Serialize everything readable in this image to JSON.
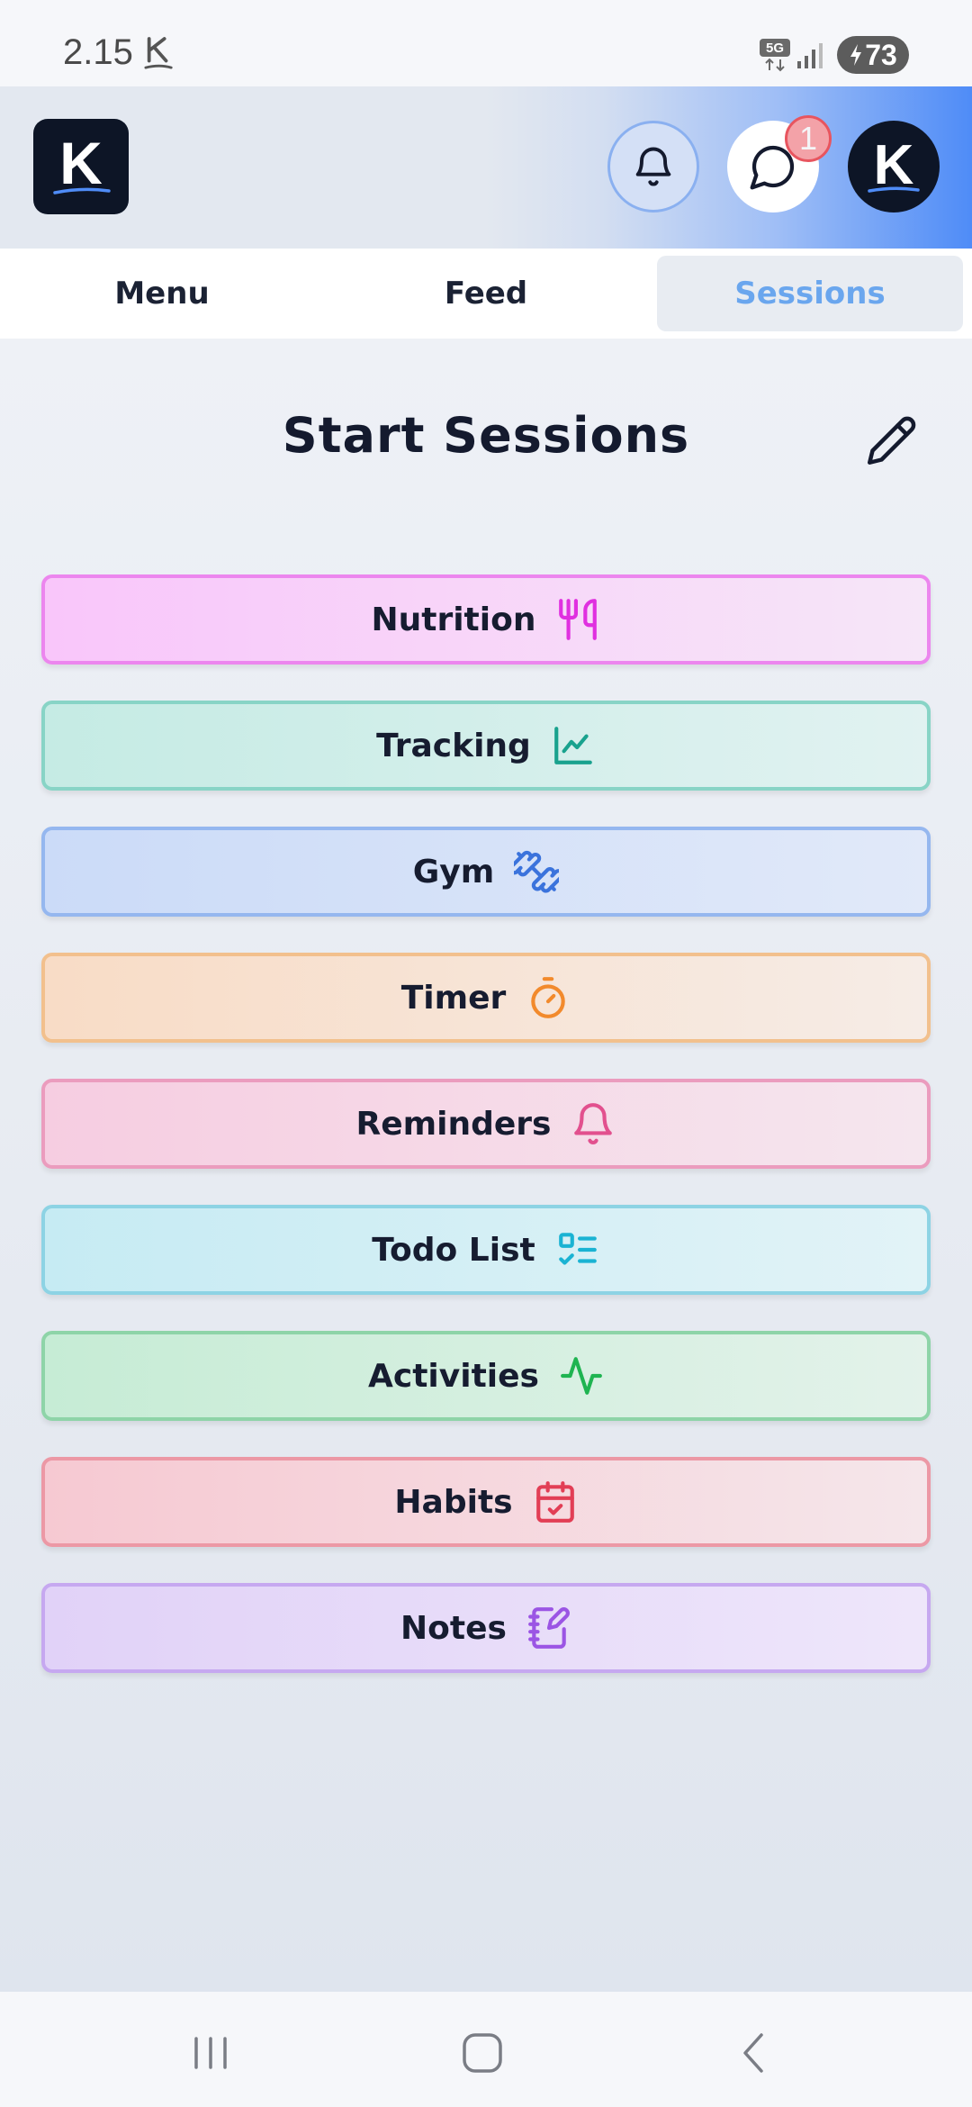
{
  "status": {
    "time": "2.15",
    "network": "5G",
    "battery": "73"
  },
  "header": {
    "logo_letter": "K",
    "avatar_letter": "K",
    "chat_badge_count": "1",
    "icons": [
      "bell-icon",
      "chat-bubble-icon"
    ]
  },
  "tabs": [
    {
      "label": "Menu",
      "active": false
    },
    {
      "label": "Feed",
      "active": false
    },
    {
      "label": "Sessions",
      "active": true
    }
  ],
  "main": {
    "title": "Start Sessions",
    "edit_icon": "pencil-icon",
    "sessions": [
      {
        "label": "Nutrition",
        "icon": "fork-knife-icon",
        "color": "#e030e0",
        "bg_from": "#f9c6fa",
        "bg_to": "#f6e6f8",
        "border": "#ec86ee"
      },
      {
        "label": "Tracking",
        "icon": "line-chart-icon",
        "color": "#19a28e",
        "bg_from": "#c5ebe4",
        "bg_to": "#e1f2f1",
        "border": "#88d4c6"
      },
      {
        "label": "Gym",
        "icon": "dumbbell-icon",
        "color": "#3b73dc",
        "bg_from": "#cbdbf8",
        "bg_to": "#e1e9f9",
        "border": "#95b7ef"
      },
      {
        "label": "Timer",
        "icon": "stopwatch-icon",
        "color": "#f28a2c",
        "bg_from": "#f8dcc6",
        "bg_to": "#f6ece6",
        "border": "#f2c08d"
      },
      {
        "label": "Reminders",
        "icon": "bell-icon",
        "color": "#e2508e",
        "bg_from": "#f6cde1",
        "bg_to": "#f5e6ee",
        "border": "#eb9cbe"
      },
      {
        "label": "Todo List",
        "icon": "checklist-icon",
        "color": "#1ab3d3",
        "bg_from": "#c6ebf3",
        "bg_to": "#e2f3f7",
        "border": "#8dd3e4"
      },
      {
        "label": "Activities",
        "icon": "activity-pulse-icon",
        "color": "#1fb451",
        "bg_from": "#c6ecd5",
        "bg_to": "#e3f2ea",
        "border": "#8ed4a8"
      },
      {
        "label": "Habits",
        "icon": "calendar-check-icon",
        "color": "#e23e55",
        "bg_from": "#f6c9d2",
        "bg_to": "#f5e6ea",
        "border": "#ec98a5"
      },
      {
        "label": "Notes",
        "icon": "notebook-pen-icon",
        "color": "#9b55e4",
        "bg_from": "#e1d2f8",
        "bg_to": "#eee6fa",
        "border": "#c6a8f0"
      }
    ]
  },
  "navbar": {
    "icons": [
      "recents-icon",
      "home-icon",
      "back-icon"
    ]
  }
}
